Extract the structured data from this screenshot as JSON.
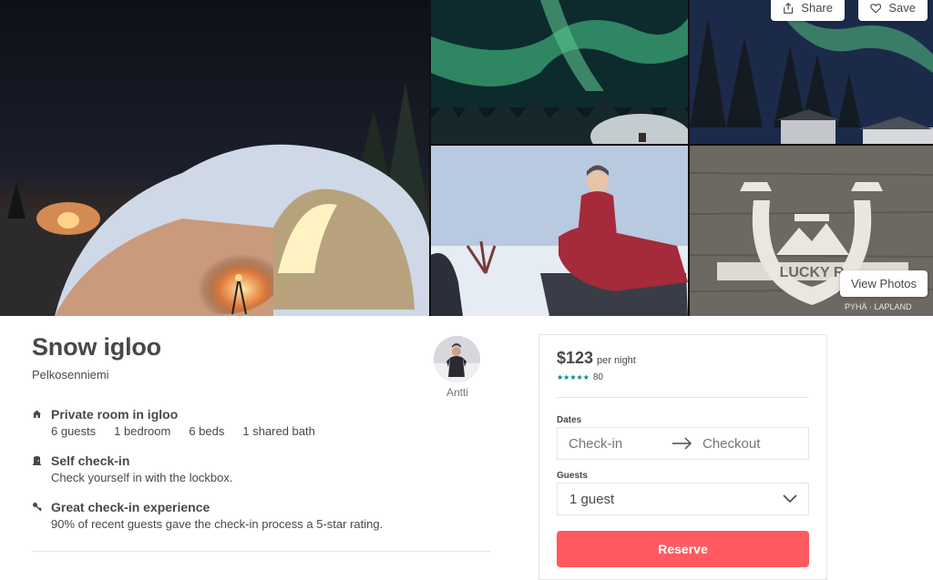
{
  "gallery": {
    "share_label": "Share",
    "save_label": "Save",
    "view_photos_label": "View Photos",
    "logo_watermark_text": "LUCKY R PYHÄ LAPLAND"
  },
  "listing": {
    "title": "Snow igloo",
    "location": "Pelkosenniemi"
  },
  "host": {
    "name": "Antti"
  },
  "features": [
    {
      "icon": "home-icon",
      "title": "Private room in igloo",
      "specs": [
        "6 guests",
        "1 bedroom",
        "6 beds",
        "1 shared bath"
      ]
    },
    {
      "icon": "door-icon",
      "title": "Self check-in",
      "subtitle": "Check yourself in with the lockbox."
    },
    {
      "icon": "key-icon",
      "title": "Great check-in experience",
      "subtitle": "90% of recent guests gave the check-in process a 5-star rating."
    }
  ],
  "booking": {
    "price": "$123",
    "price_unit": "per night",
    "stars": "★★★★★",
    "rating": 5,
    "review_count": "80",
    "dates_label": "Dates",
    "checkin_placeholder": "Check-in",
    "checkout_placeholder": "Checkout",
    "guests_label": "Guests",
    "guests_value": "1 guest",
    "reserve_label": "Reserve"
  },
  "colors": {
    "accent": "#ff5a5f",
    "star": "#008489",
    "text": "#484848",
    "muted": "#767676",
    "border": "#e4e4e4"
  }
}
